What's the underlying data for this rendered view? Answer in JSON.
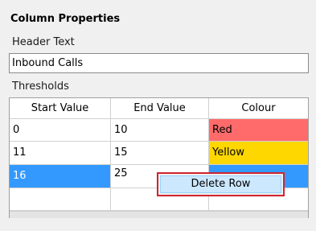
{
  "panel": {
    "title": "Column Properties",
    "header_text_label": "Header Text",
    "header_text_value": "Inbound Calls",
    "thresholds_label": "Thresholds"
  },
  "thresholds_grid": {
    "columns": [
      "Start Value",
      "End Value",
      "Colour"
    ],
    "rows": [
      {
        "start": "0",
        "end": "10",
        "colour": "Red",
        "colour_hex": "#ff6b6b"
      },
      {
        "start": "11",
        "end": "15",
        "colour": "Yellow",
        "colour_hex": "#ffd700"
      },
      {
        "start": "16",
        "end": "25",
        "colour": "",
        "colour_hex": "#3399ff",
        "selected": true
      }
    ]
  },
  "context_menu": {
    "items": [
      "Delete Row"
    ]
  },
  "colors": {
    "selection": "#3399ff",
    "menu_highlight": "#cce8ff",
    "callout_border": "#d0252f"
  }
}
